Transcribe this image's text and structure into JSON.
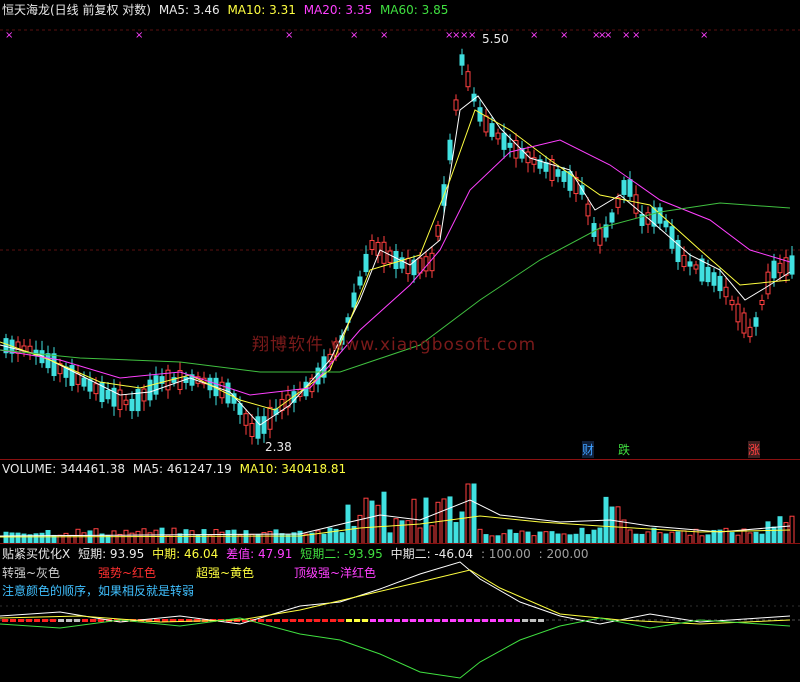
{
  "price": {
    "title": "恒天海龙(日线 前复权 对数)",
    "ma5_label": "MA5: 3.46",
    "ma10_label": "MA10: 3.31",
    "ma20_label": "MA20: 3.35",
    "ma60_label": "MA60: 3.85",
    "high_label": "5.50",
    "low_label": "2.38",
    "tag_cai": "财",
    "tag_die": "跌",
    "tag_zhang": "涨",
    "watermark": "翔博软件 www.xiangbosoft.com",
    "colors": {
      "up": "#ff4040",
      "down": "#40e0e0",
      "ma5": "#ffffff",
      "ma10": "#ffff40",
      "ma20": "#ff40ff",
      "ma60": "#40c040",
      "marker": "#ff40ff"
    }
  },
  "volume": {
    "volume_label": "VOLUME: 344461.38",
    "ma5_label": "MA5: 461247.19",
    "ma10_label": "MA10: 340418.81"
  },
  "indicator": {
    "name": "贴紧买优化X",
    "short": "短期: 93.95",
    "mid": "中期: 46.04",
    "diff": "差值: 47.91",
    "short2": "短期二: -93.95",
    "mid2": "中期二: -46.04",
    "l100": ": 100.00",
    "l200": ": 200.00",
    "legend_gray": "转强~灰色",
    "legend_red": "强势~红色",
    "legend_yellow": "超强~黄色",
    "legend_magenta": "顶级强~洋红色",
    "note": "注意颜色的顺序，如果相反就是转弱"
  }
}
